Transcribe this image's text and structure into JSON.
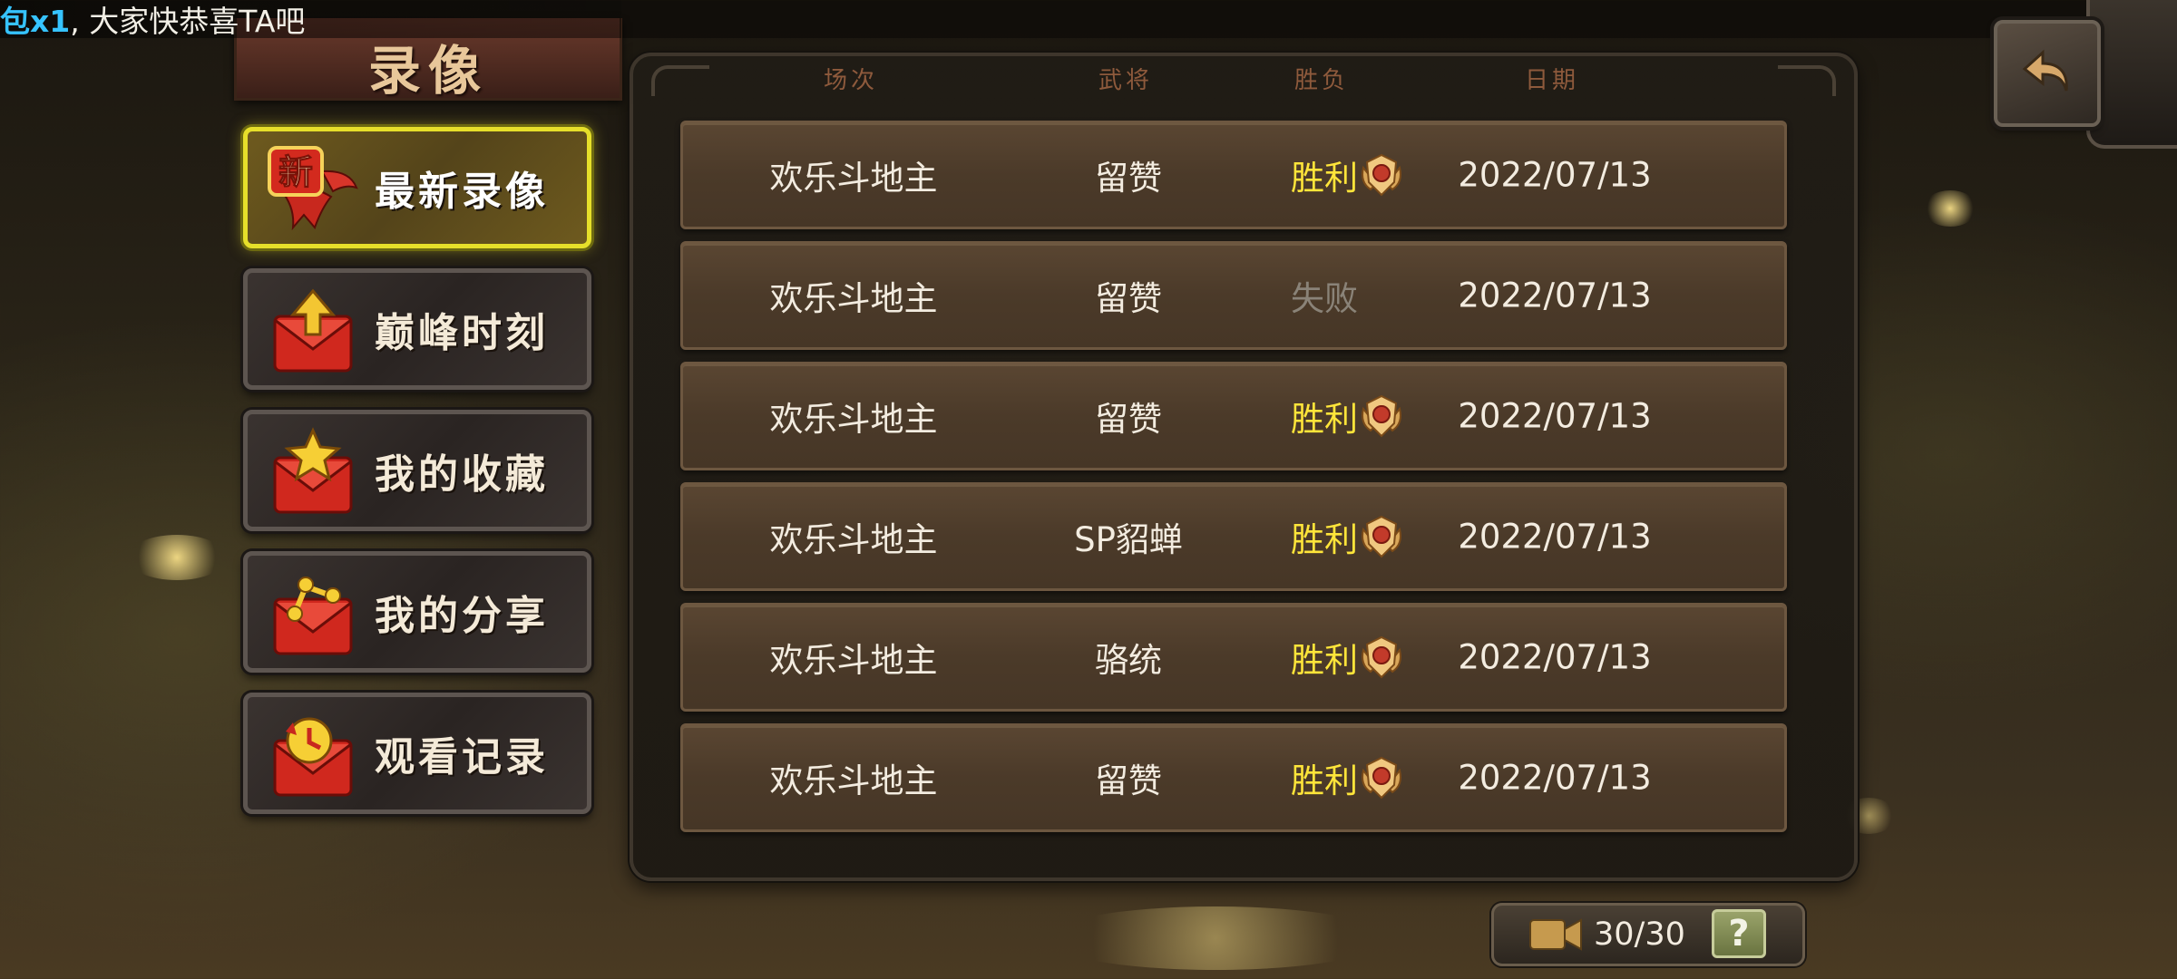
{
  "ticker": {
    "highlight": "包x1",
    "message": ", 大家快恭喜TA吧"
  },
  "title": "录像",
  "sidebar": {
    "items": [
      {
        "label": "最新录像",
        "badge": "新",
        "icon": "new-ribbon-icon",
        "active": true
      },
      {
        "label": "巅峰时刻",
        "icon": "red-envelope-arrow-icon",
        "active": false
      },
      {
        "label": "我的收藏",
        "icon": "red-envelope-star-icon",
        "active": false
      },
      {
        "label": "我的分享",
        "icon": "red-envelope-share-icon",
        "active": false
      },
      {
        "label": "观看记录",
        "icon": "red-envelope-clock-icon",
        "active": false
      }
    ]
  },
  "table": {
    "headers": {
      "mode": "场次",
      "general": "武将",
      "result": "胜负",
      "date": "日期"
    },
    "rows": [
      {
        "mode": "欢乐斗地主",
        "general": "留赞",
        "result": "胜利",
        "win": true,
        "date": "2022/07/13"
      },
      {
        "mode": "欢乐斗地主",
        "general": "留赞",
        "result": "失败",
        "win": false,
        "date": "2022/07/13"
      },
      {
        "mode": "欢乐斗地主",
        "general": "留赞",
        "result": "胜利",
        "win": true,
        "date": "2022/07/13"
      },
      {
        "mode": "欢乐斗地主",
        "general": "SP貂蝉",
        "result": "胜利",
        "win": true,
        "date": "2022/07/13"
      },
      {
        "mode": "欢乐斗地主",
        "general": "骆统",
        "result": "胜利",
        "win": true,
        "date": "2022/07/13"
      },
      {
        "mode": "欢乐斗地主",
        "general": "留赞",
        "result": "胜利",
        "win": true,
        "date": "2022/07/13"
      }
    ]
  },
  "footer": {
    "count": "30/30",
    "help": "?"
  },
  "colors": {
    "win": "#ffe53a",
    "lose": "#8a8378",
    "active_border": "#e6df2a"
  }
}
